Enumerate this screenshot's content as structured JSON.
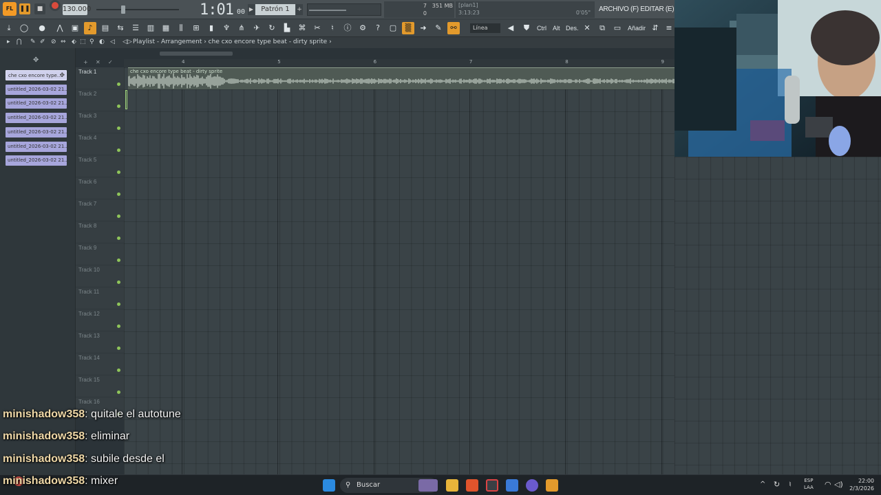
{
  "transport": {
    "tempo": "130.000",
    "time_main": "1:01",
    "time_sub": "00",
    "pattern": "Patrón 1",
    "cpu": "7",
    "ram": "351 MB",
    "polyphony": "0",
    "hint_line1": "[plan1]",
    "hint_line2": "3:13:23",
    "hint_right": "0'05\"",
    "menu_title": "ARCHIVO (F) EDITAR (E) AÑADIR"
  },
  "toolbar": {
    "snap_label": "Línea",
    "ctrl_label": "Ctrl",
    "alt_label": "Alt",
    "des_label": "Des.",
    "add_label": "Añadir"
  },
  "playlist": {
    "title": "Playlist - Arrangement › che cxo encore type beat - dirty sprite ›",
    "ruler_numbers": [
      "4",
      "5",
      "6",
      "7",
      "8",
      "9"
    ]
  },
  "picker": {
    "clips": [
      "che cxo encore type...",
      "untitled_2026-03-02 21...",
      "untitled_2026-03-02 21...",
      "untitled_2026-03-02 21...",
      "untitled_2026-03-02 21...",
      "untitled_2026-03-02 21...",
      "untitled_2026-03-02 21..."
    ]
  },
  "tracks": [
    "Track 1",
    "Track 2",
    "Track 3",
    "Track 4",
    "Track 5",
    "Track 6",
    "Track 7",
    "Track 8",
    "Track 9",
    "Track 10",
    "Track 11",
    "Track 12",
    "Track 13",
    "Track 14",
    "Track 15",
    "Track 16"
  ],
  "audio_clip": {
    "label": "che cxo encore type beat - dirty sprite"
  },
  "chat": [
    {
      "user": "minishadow358",
      "text": "quitale el autotune"
    },
    {
      "user": "minishadow358",
      "text": "eliminar"
    },
    {
      "user": "minishadow358",
      "text": "subile desde el"
    },
    {
      "user": "minishadow358",
      "text": "mixer"
    }
  ],
  "taskbar": {
    "search_label": "Buscar",
    "lang_line1": "ESP",
    "lang_line2": "LAA",
    "time": "22:00",
    "date": "2/3/2026"
  },
  "colors": {
    "accent": "#e39a2c",
    "clip_color": "#a7a6dc",
    "track_led": "#8fc55a"
  }
}
